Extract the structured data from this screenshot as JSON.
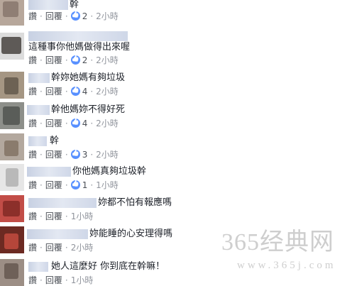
{
  "comments": [
    {
      "text": "幹",
      "reply_label": "讚",
      "reply2_label": "回覆",
      "likes": "2",
      "time": "2小時"
    },
    {
      "text": "這種事你他媽做得出來喔",
      "reply_label": "讚",
      "reply2_label": "回覆",
      "likes": "2",
      "time": "2小時"
    },
    {
      "text": "幹妳她媽有夠垃圾",
      "reply_label": "讚",
      "reply2_label": "回覆",
      "likes": "4",
      "time": "2小時"
    },
    {
      "text": "幹他媽妳不得好死",
      "reply_label": "讚",
      "reply2_label": "回覆",
      "likes": "4",
      "time": "2小時"
    },
    {
      "text": "幹",
      "reply_label": "讚",
      "reply2_label": "回覆",
      "likes": "3",
      "time": "2小時"
    },
    {
      "text": "你他媽真夠垃圾幹",
      "reply_label": "讚",
      "reply2_label": "回覆",
      "likes": "1",
      "time": "1小時"
    },
    {
      "text": "妳都不怕有報應嗎",
      "reply_label": "讚",
      "reply2_label": "回覆",
      "likes": "",
      "time": "1小時"
    },
    {
      "text": "妳能睡的心安理得嗎",
      "reply_label": "讚",
      "reply2_label": "回覆",
      "likes": "",
      "time": "2小時"
    },
    {
      "text": "她人這麼好 你到底在幹嘛！",
      "reply_label": "讚",
      "reply2_label": "回覆",
      "likes": "",
      "time": "1小時"
    }
  ],
  "watermark": {
    "main": "365经典网",
    "sub": "www.365j.com"
  },
  "colors": {
    "like": "#5890ff",
    "meta": "#90949c",
    "text": "#1d2129",
    "name_blur": "#c8d1e3"
  }
}
